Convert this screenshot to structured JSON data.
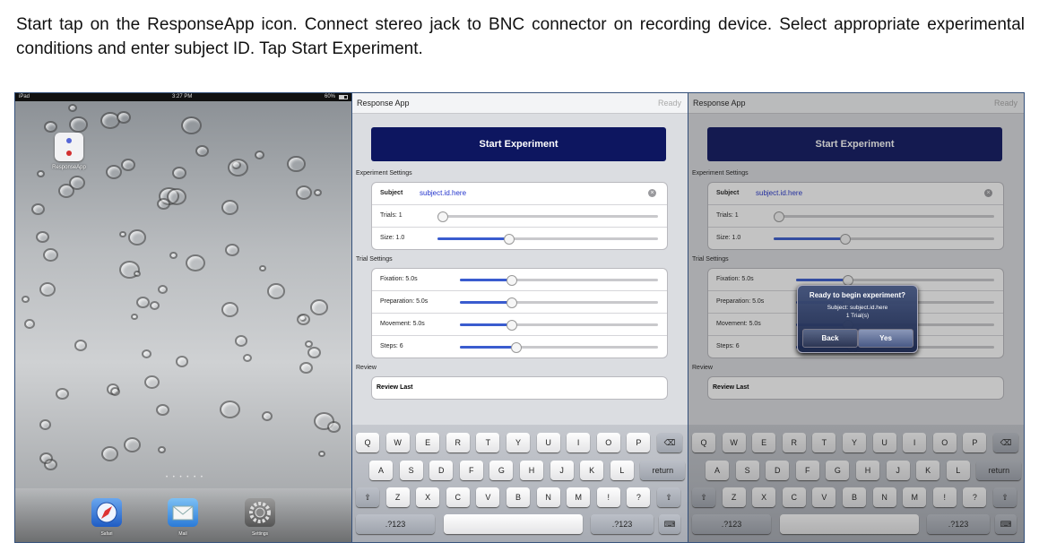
{
  "caption": "Start tap on the ResponseApp icon. Connect stereo jack to BNC connector on recording device. Select appropriate experimental conditions and enter subject ID. Tap Start Experiment.",
  "home": {
    "carrier": "iPad",
    "time": "3:27 PM",
    "battery": "60%",
    "app_label": "ResponseApp",
    "page_dots": "• • • • • •",
    "dock": [
      {
        "label": "Safari",
        "icon": "safari-compass-icon",
        "color": "#3a7ad8"
      },
      {
        "label": "Mail",
        "icon": "mail-envelope-icon",
        "color": "#3a8ee0"
      },
      {
        "label": "Settings",
        "icon": "settings-gear-icon",
        "color": "#7a7a7a"
      }
    ]
  },
  "app": {
    "title": "Response App",
    "status": "Ready",
    "start_button": "Start Experiment",
    "experiment_settings_header": "Experiment Settings",
    "subject_label": "Subject",
    "subject_value": "subject.id.here",
    "trials_label": "Trials: 1",
    "size_label": "Size: 1.0",
    "trial_settings_header": "Trial Settings",
    "fixation_label": "Fixation: 5.0s",
    "preparation_label": "Preparation: 5.0s",
    "movement_label": "Movement: 5.0s",
    "steps_label": "Steps: 6",
    "review_header": "Review",
    "review_button": "Review Last",
    "slider_levels": {
      "trials": 0.02,
      "size": 0.32,
      "fixation": 0.26,
      "preparation": 0.26,
      "movement": 0.26,
      "steps": 0.28
    },
    "accent_color": "#0d1660"
  },
  "keyboard": {
    "row1": [
      "Q",
      "W",
      "E",
      "R",
      "T",
      "Y",
      "U",
      "I",
      "O",
      "P",
      "⌫"
    ],
    "row2": [
      "A",
      "S",
      "D",
      "F",
      "G",
      "H",
      "J",
      "K",
      "L",
      "return"
    ],
    "row3": [
      "⇧",
      "Z",
      "X",
      "C",
      "V",
      "B",
      "N",
      "M",
      "!",
      ",",
      "?",
      ".",
      "⇧"
    ],
    "row3_display": [
      "⇧",
      "Z",
      "X",
      "C",
      "V",
      "B",
      "N",
      "M",
      "!",
      "?",
      "⇧"
    ],
    "numbers_key": ".?123",
    "hide_keyboard": "⌨"
  },
  "dialog": {
    "title": "Ready to begin experiment?",
    "line1": "Subject: subject.id.here",
    "line2": "1 Trial(s)",
    "back": "Back",
    "yes": "Yes"
  }
}
